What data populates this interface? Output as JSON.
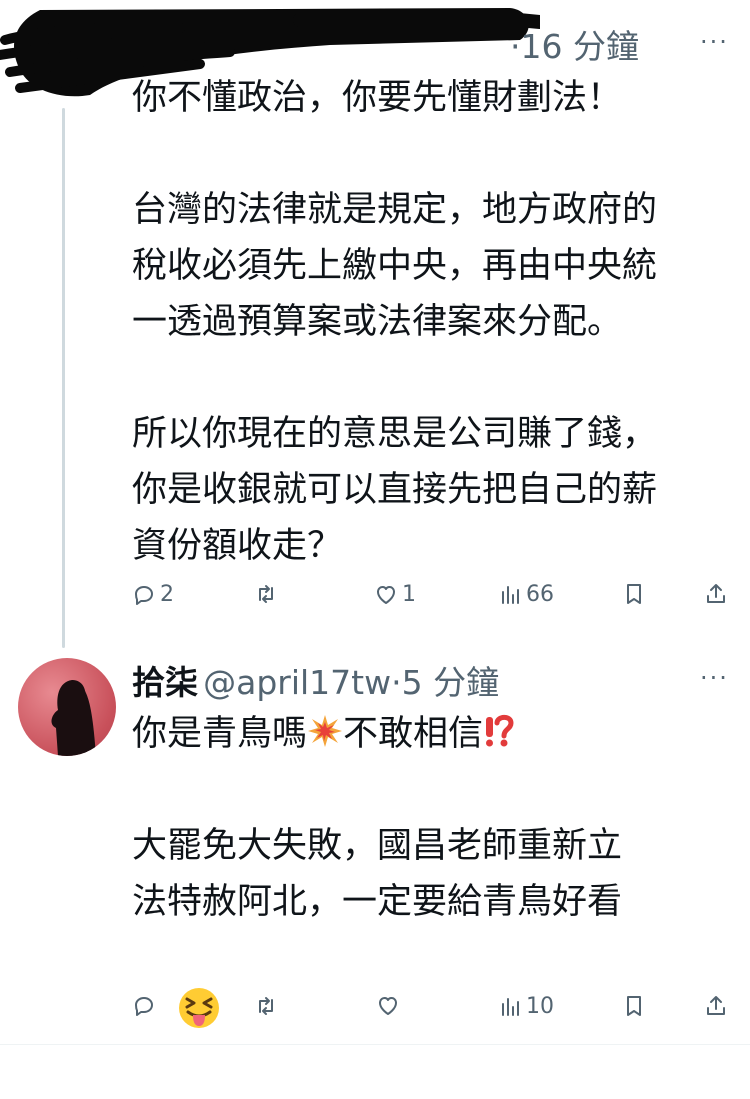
{
  "tweet1": {
    "time": "·16 分鐘",
    "more": "···",
    "text": "你不懂政治，你要先懂財劃法！\n\n台灣的法律就是規定，地方政府的\n稅收必須先上繳中央，再由中央統\n一透過預算案或法律案來分配。\n\n所以你現在的意思是公司賺了錢，\n你是收銀就可以直接先把自己的薪\n資份額收走？",
    "actions": {
      "replies": "2",
      "retweets": "",
      "likes": "1",
      "views": "66"
    }
  },
  "tweet2": {
    "name": "拾柒",
    "handle": "@april17tw",
    "time": "·5 分鐘",
    "more": "···",
    "line1_a": "你是青鳥嗎",
    "line1_b": "不敢相信",
    "body": "大罷免大失敗，國昌老師重新立\n法特赦阿北，一定要給青鳥好看",
    "actions": {
      "replies": "",
      "retweets": "",
      "likes": "",
      "views": "10"
    }
  },
  "icons": [
    "reply-icon",
    "retweet-icon",
    "like-icon",
    "views-icon",
    "bookmark-icon",
    "share-icon",
    "collision-emoji",
    "exclamation-question-emoji",
    "squinting-tongue-emoji"
  ]
}
